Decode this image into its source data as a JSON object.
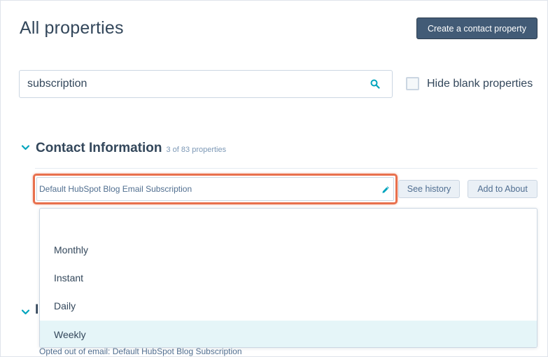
{
  "header": {
    "title": "All properties",
    "create_button": "Create a contact property"
  },
  "search": {
    "value": "subscription",
    "icon": "search-icon"
  },
  "filter": {
    "hide_blank_label": "Hide blank properties",
    "checked": false
  },
  "section": {
    "title": "Contact Information",
    "count": "3 of 83 properties",
    "expanded": true
  },
  "property": {
    "label": "Default HubSpot Blog Email Subscription",
    "edit_icon": "pencil-icon",
    "see_history": "See history",
    "add_to_about": "Add to About"
  },
  "dropdown": {
    "options": [
      {
        "label": ""
      },
      {
        "label": "Monthly"
      },
      {
        "label": "Instant"
      },
      {
        "label": "Daily"
      },
      {
        "label": "Weekly"
      }
    ],
    "highlighted": "Weekly"
  },
  "next_section": {
    "title_fragment": "I",
    "partial_text": "Opted out of email: Default HubSpot Blog Subscription"
  },
  "colors": {
    "primary_button": "#425b76",
    "highlight_border": "#e8704d",
    "accent": "#00a4bd",
    "selected_option_bg": "#e5f5f8"
  }
}
